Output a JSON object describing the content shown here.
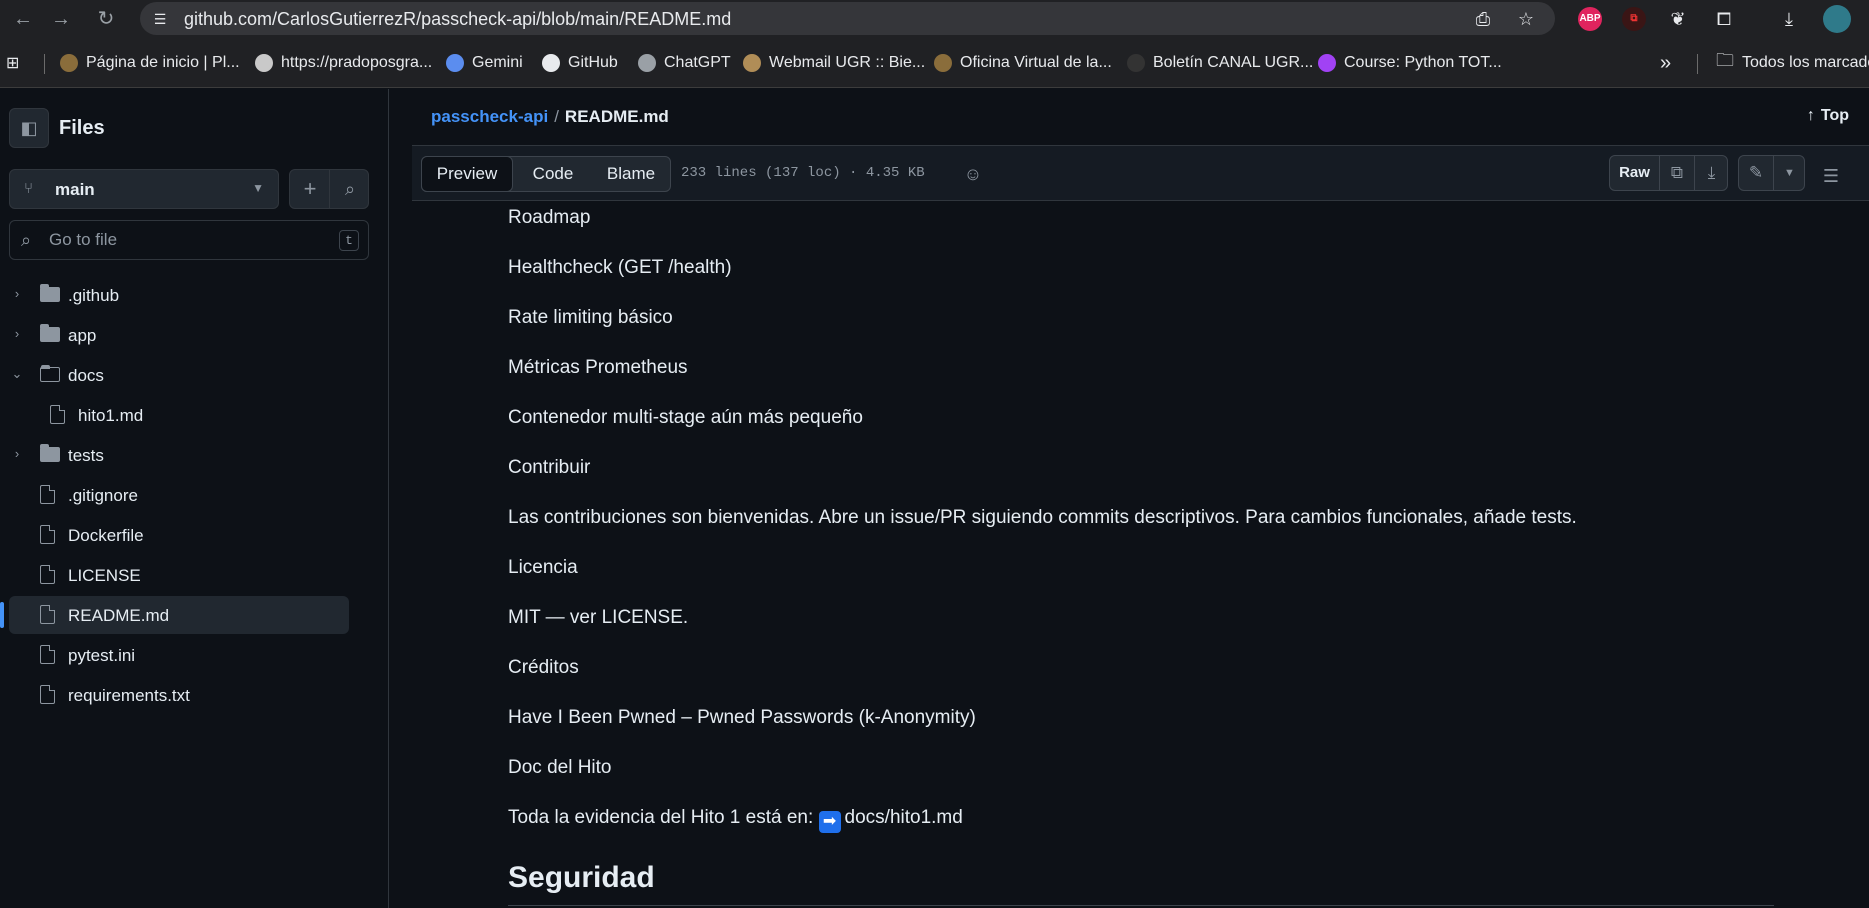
{
  "browser": {
    "url": "github.com/CarlosGutierrezR/passcheck-api/blob/main/README.md",
    "bookmarks": [
      {
        "label": "Página de inicio | Pl..."
      },
      {
        "label": "https://pradoposgra..."
      },
      {
        "label": "Gemini"
      },
      {
        "label": "GitHub"
      },
      {
        "label": "ChatGPT"
      },
      {
        "label": "Webmail UGR :: Bie..."
      },
      {
        "label": "Oficina Virtual de la..."
      },
      {
        "label": "Boletín CANAL UGR..."
      },
      {
        "label": "Course: Python TOT..."
      }
    ],
    "overflow": "»",
    "all_bookmarks": "Todos los marcado",
    "ext_abp": "ABP"
  },
  "sidebar": {
    "title": "Files",
    "branch": "main",
    "goto_placeholder": "Go to file",
    "goto_key": "t",
    "tree": [
      {
        "label": ".github",
        "type": "folder",
        "expanded": false
      },
      {
        "label": "app",
        "type": "folder",
        "expanded": false
      },
      {
        "label": "docs",
        "type": "folder",
        "expanded": true
      },
      {
        "label": "hito1.md",
        "type": "file",
        "indent": true
      },
      {
        "label": "tests",
        "type": "folder",
        "expanded": false
      },
      {
        "label": ".gitignore",
        "type": "file"
      },
      {
        "label": "Dockerfile",
        "type": "file"
      },
      {
        "label": "LICENSE",
        "type": "file"
      },
      {
        "label": "README.md",
        "type": "file",
        "active": true
      },
      {
        "label": "pytest.ini",
        "type": "file"
      },
      {
        "label": "requirements.txt",
        "type": "file"
      }
    ]
  },
  "header": {
    "repo": "passcheck-api",
    "sep": "/",
    "file": "README.md",
    "top": "Top"
  },
  "toolbar": {
    "tabs": [
      "Preview",
      "Code",
      "Blame"
    ],
    "selected_tab": "Preview",
    "fileinfo": "233 lines (137 loc) · 4.35 KB",
    "raw": "Raw"
  },
  "content": {
    "paragraphs": [
      "Roadmap",
      "Healthcheck (GET /health)",
      "Rate limiting básico",
      "Métricas Prometheus",
      "Contenedor multi-stage aún más pequeño",
      "Contribuir",
      "Las contribuciones son bienvenidas. Abre un issue/PR siguiendo commits descriptivos. Para cambios funcionales, añade tests.",
      "Licencia",
      "MIT — ver LICENSE.",
      "Créditos",
      "Have I Been Pwned – Pwned Passwords (k-Anonymity)",
      "Doc del Hito"
    ],
    "evidence_text": "Toda la evidencia del Hito 1 está en: ",
    "evidence_link": "docs/hito1.md",
    "heading": "Seguridad"
  },
  "colors": {
    "bg": "#0d1117",
    "link": "#4493f8",
    "text": "#e6edf3",
    "muted": "#8d96a0"
  }
}
